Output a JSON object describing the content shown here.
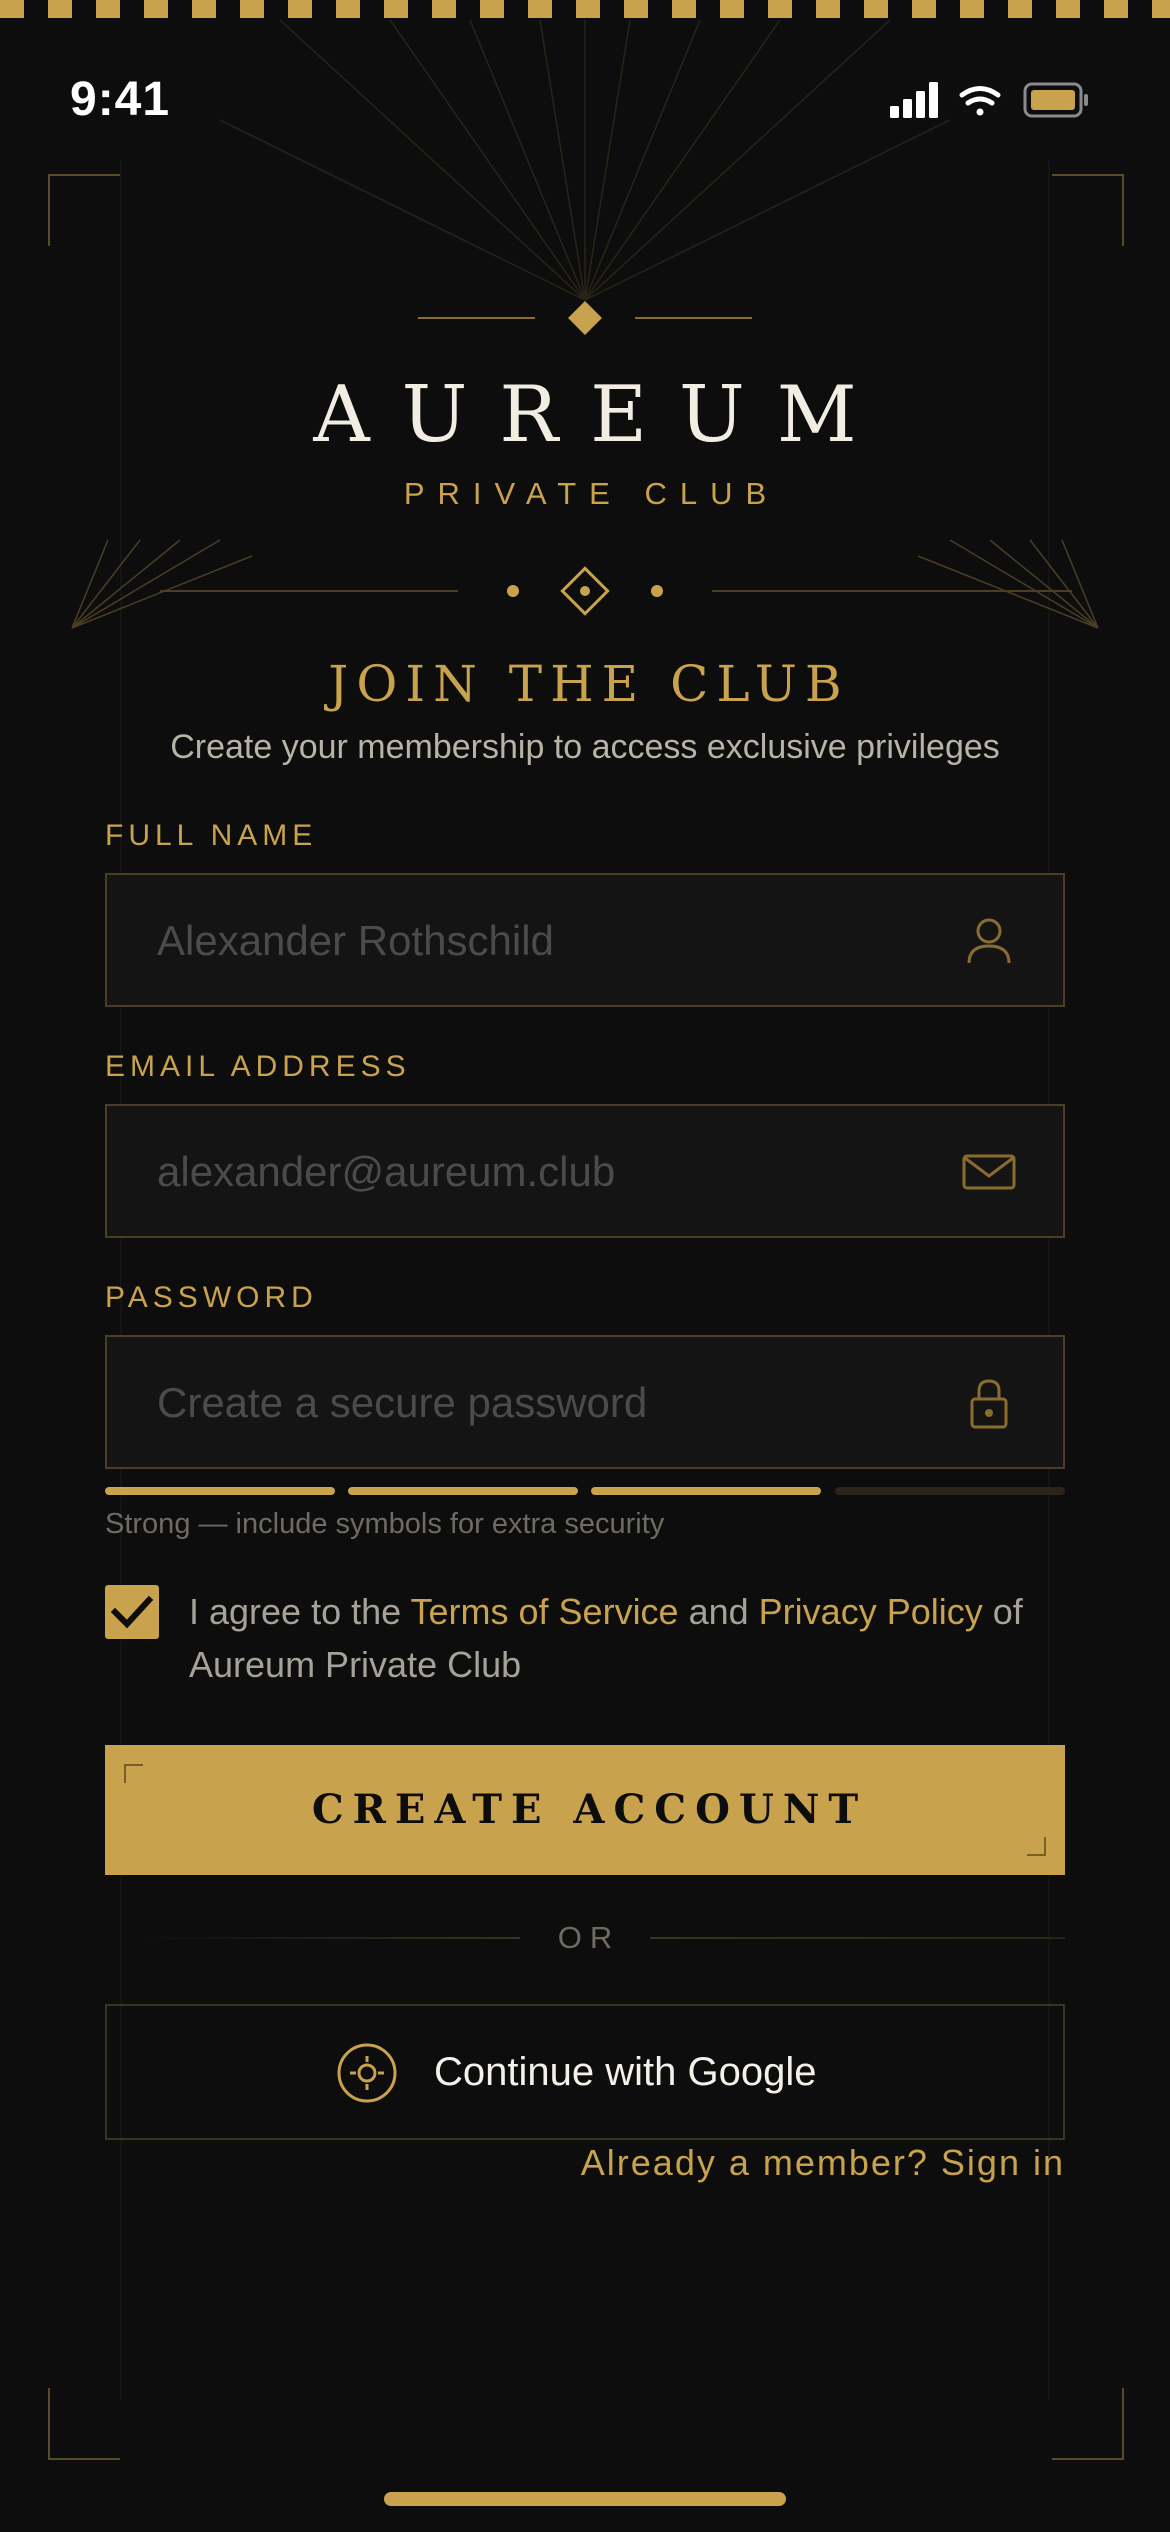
{
  "status_bar": {
    "time": "9:41"
  },
  "brand": {
    "name": "AUREUM",
    "tagline": "PRIVATE CLUB"
  },
  "form": {
    "title": "JOIN THE CLUB",
    "subtitle": "Create your membership to access exclusive privileges",
    "full_name": {
      "label": "FULL NAME",
      "placeholder": "Alexander Rothschild",
      "icon": "user-icon"
    },
    "email": {
      "label": "EMAIL ADDRESS",
      "placeholder": "alexander@aureum.club",
      "icon": "mail-icon"
    },
    "password": {
      "label": "PASSWORD",
      "placeholder": "Create a secure password",
      "icon": "lock-icon",
      "strength_segments_filled": 3,
      "strength_segments_total": 4,
      "strength_hint": "Strong — include symbols for extra security"
    },
    "agreement": {
      "checked": true,
      "prefix": "I agree to the ",
      "terms_link": "Terms of Service",
      "middle": " and ",
      "privacy_link": "Privacy Policy",
      "suffix": " of Aureum Private Club"
    },
    "submit_label": "CREATE ACCOUNT",
    "divider_label": "OR",
    "google_label": "Continue with Google",
    "signin_link": "Already a member? Sign in"
  },
  "colors": {
    "accent": "#c9a24e",
    "background": "#0d0d0d",
    "field_bg": "#141414",
    "text_primary": "#f1ede2"
  }
}
